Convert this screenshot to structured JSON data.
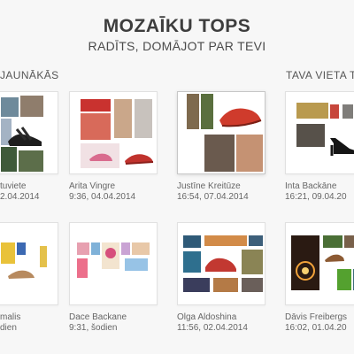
{
  "header": {
    "title": "MOZAĪKU TOPS",
    "subtitle": "RADĪTS, DOMĀJOT PAR TEVI"
  },
  "sections": {
    "newest": "JAUNĀKĀS",
    "your_place": "TAVA VIETA TO"
  },
  "cards": [
    {
      "name": "tuviete",
      "time": "2.04.2014"
    },
    {
      "name": "Arita Vingre",
      "time": "9:36, 04.04.2014"
    },
    {
      "name": "Justīne Kreitūze",
      "time": "16:54, 07.04.2014"
    },
    {
      "name": "Inta Backāne",
      "time": "16:21, 09.04.20"
    },
    {
      "name": "malis",
      "time": "dien"
    },
    {
      "name": "Dace Backane",
      "time": "9:31, šodien"
    },
    {
      "name": "Olga Aldoshina",
      "time": "11:56, 02.04.2014"
    },
    {
      "name": "Dāvis Freibergs",
      "time": "16:02, 01.04.20"
    }
  ]
}
